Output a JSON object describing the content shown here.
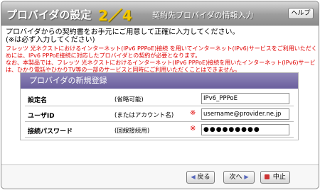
{
  "header": {
    "title": "プロバイダの設定",
    "step": "2／4",
    "subtitle": "契約先プロバイダの情報入力",
    "help_label": "ヘルプ"
  },
  "intro": {
    "line1": "プロバイダからの契約書をお手元にご用意して正確に入力してください。",
    "line2": "(※は必ず入力してください)"
  },
  "notes": {
    "line1": "フレッツ 光ネクストにおけるインターネット(IPv6 PPPoE)接続 を用いてインターネット(IPv6)サービスをご利用いただくた",
    "line2": "めには、IPv6 PPPoE接続に対応したプロバイダとの契約が必要となります。",
    "line3": "なお、本製品では、フレッツ 光ネクストにおけるインターネット(IPv6 PPPoE)接続を用いたインターネット(IPv6)サービス",
    "line4": "は、ひかり電話やひかりTV等の一部のサービスと同時にご利用いただくことはできません。"
  },
  "form": {
    "section_title": "プロバイダの新規登録",
    "rows": [
      {
        "label": "設定名",
        "hint": "(省略可能)",
        "required": "",
        "value": "IPv6_PPPoE"
      },
      {
        "label": "ユーザID",
        "hint": "(またはアカウント名)",
        "required": "※",
        "value": "username@provider.ne.jp"
      },
      {
        "label": "接続パスワード",
        "hint": "(回線接続用)",
        "required": "※",
        "value": "●●●●●●●●●"
      }
    ]
  },
  "footer": {
    "back_label": "戻る",
    "next_label": "次へ",
    "cancel_label": "中止"
  },
  "colors": {
    "title_step": "#f5c800",
    "notes_text": "#e00000",
    "section_header": "#6a5f9d"
  },
  "icons": {
    "back": "left-arrow-icon",
    "next": "right-arrow-icon",
    "cancel": "stop-icon"
  }
}
